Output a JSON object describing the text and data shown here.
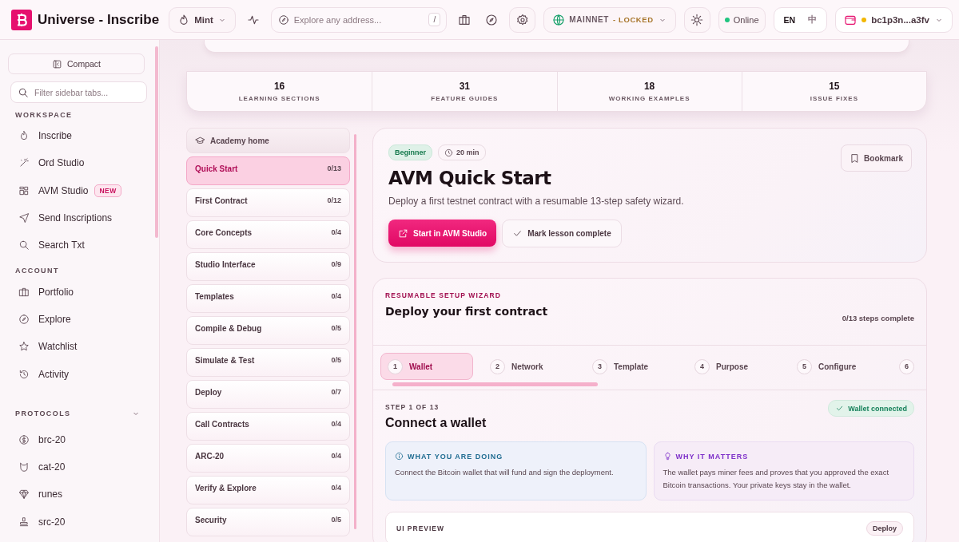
{
  "header": {
    "brand": "Universe - Inscribe",
    "mode_menu": {
      "label": "Mint"
    },
    "search": {
      "placeholder": "Explore any address...",
      "shortcut": "/"
    },
    "network": {
      "label": "MAINNET",
      "lock": "- LOCKED"
    },
    "status": {
      "label": "Online"
    },
    "languages": [
      {
        "label": "EN",
        "selected": true
      },
      {
        "label": "中",
        "selected": false
      }
    ],
    "wallet": {
      "address": "bc1p3n...a3fv"
    }
  },
  "sidebar": {
    "compact_button": "Compact",
    "filter": {
      "placeholder": "Filter sidebar tabs..."
    },
    "sections": [
      {
        "title": "WORKSPACE",
        "items": [
          {
            "label": "Inscribe"
          },
          {
            "label": "Ord Studio"
          },
          {
            "label": "AVM Studio",
            "badge": "NEW"
          },
          {
            "label": "Send Inscriptions"
          },
          {
            "label": "Search Txt"
          }
        ]
      },
      {
        "title": "ACCOUNT",
        "items": [
          {
            "label": "Portfolio"
          },
          {
            "label": "Explore"
          },
          {
            "label": "Watchlist"
          },
          {
            "label": "Activity"
          }
        ]
      },
      {
        "title": "PROTOCOLS",
        "expanded": true,
        "items": [
          {
            "label": "brc-20"
          },
          {
            "label": "cat-20"
          },
          {
            "label": "runes"
          },
          {
            "label": "src-20"
          }
        ]
      }
    ]
  },
  "stats": [
    {
      "value": "16",
      "label": "LEARNING SECTIONS"
    },
    {
      "value": "31",
      "label": "FEATURE GUIDES"
    },
    {
      "value": "18",
      "label": "WORKING EXAMPLES"
    },
    {
      "value": "15",
      "label": "ISSUE FIXES"
    }
  ],
  "lessons": {
    "home": "Academy home",
    "items": [
      {
        "title": "Quick Start",
        "progress": "0/13",
        "selected": true
      },
      {
        "title": "First Contract",
        "progress": "0/12",
        "selected": false
      },
      {
        "title": "Core Concepts",
        "progress": "0/4",
        "selected": false
      },
      {
        "title": "Studio Interface",
        "progress": "0/9",
        "selected": false
      },
      {
        "title": "Templates",
        "progress": "0/4",
        "selected": false
      },
      {
        "title": "Compile & Debug",
        "progress": "0/5",
        "selected": false
      },
      {
        "title": "Simulate & Test",
        "progress": "0/5",
        "selected": false
      },
      {
        "title": "Deploy",
        "progress": "0/7",
        "selected": false
      },
      {
        "title": "Call Contracts",
        "progress": "0/4",
        "selected": false
      },
      {
        "title": "ARC-20",
        "progress": "0/4",
        "selected": false
      },
      {
        "title": "Verify & Explore",
        "progress": "0/4",
        "selected": false
      },
      {
        "title": "Security",
        "progress": "0/5",
        "selected": false
      }
    ]
  },
  "lesson": {
    "level": "Beginner",
    "duration": "20 min",
    "bookmark": "Bookmark",
    "title": "AVM Quick Start",
    "description": "Deploy a first testnet contract with a resumable 13-step safety wizard.",
    "primary_button": "Start in AVM Studio",
    "secondary_button": "Mark lesson complete"
  },
  "wizard": {
    "eyebrow": "RESUMABLE SETUP WIZARD",
    "title": "Deploy your first contract",
    "progress": "0/13 steps complete",
    "steps": [
      {
        "number": "1",
        "label": "Wallet",
        "selected": true
      },
      {
        "number": "2",
        "label": "Network",
        "selected": false
      },
      {
        "number": "3",
        "label": "Template",
        "selected": false
      },
      {
        "number": "4",
        "label": "Purpose",
        "selected": false
      },
      {
        "number": "5",
        "label": "Configure",
        "selected": false
      },
      {
        "number": "6",
        "selected": false
      }
    ],
    "step": {
      "counter": "STEP 1 OF 13",
      "title": "Connect a wallet",
      "status": "Wallet connected",
      "cards": [
        {
          "kind": "info",
          "title": "WHAT YOU ARE DOING",
          "text": "Connect the Bitcoin wallet that will fund and sign the deployment."
        },
        {
          "kind": "why",
          "title": "WHY IT MATTERS",
          "text": "The wallet pays miner fees and proves that you approved the exact Bitcoin transactions. Your private keys stay in the wallet."
        }
      ],
      "preview": {
        "title": "UI PREVIEW",
        "badge": "Deploy"
      }
    }
  }
}
